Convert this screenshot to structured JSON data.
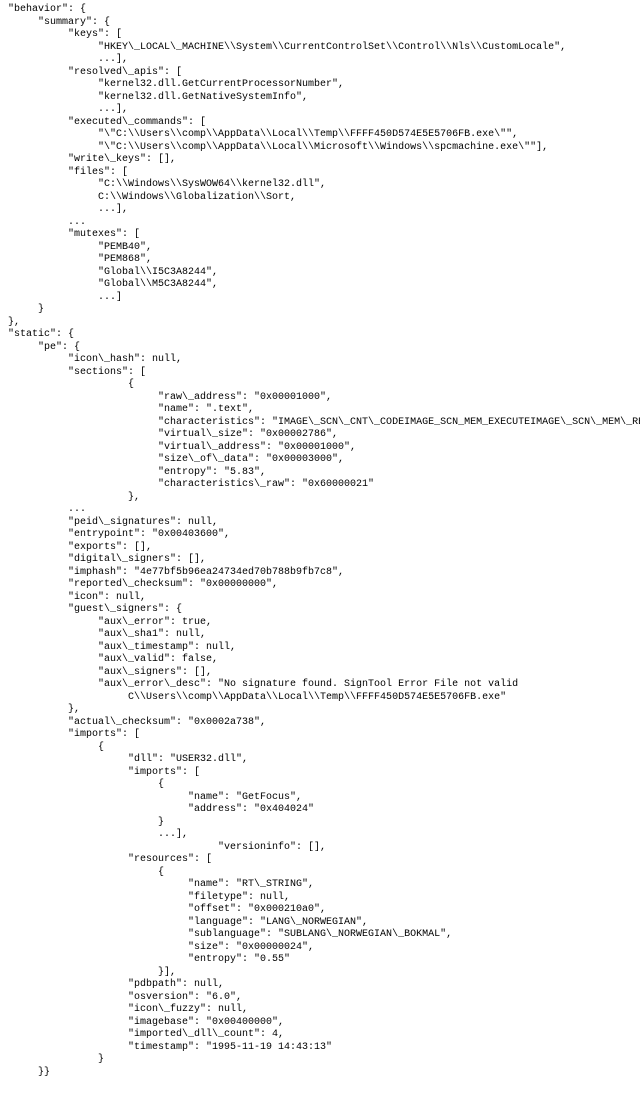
{
  "lines": [
    {
      "indent": 0,
      "text": "\"behavior\": {"
    },
    {
      "indent": 1,
      "text": "\"summary\": {"
    },
    {
      "indent": 2,
      "text": "\"keys\": ["
    },
    {
      "indent": 3,
      "text": "\"HKEY\\_LOCAL\\_MACHINE\\\\System\\\\CurrentControlSet\\\\Control\\\\Nls\\\\CustomLocale\","
    },
    {
      "indent": 3,
      "text": "...],"
    },
    {
      "indent": 2,
      "text": "\"resolved\\_apis\": ["
    },
    {
      "indent": 3,
      "text": "\"kernel32.dll.GetCurrentProcessorNumber\","
    },
    {
      "indent": 3,
      "text": "\"kernel32.dll.GetNativeSystemInfo\","
    },
    {
      "indent": 3,
      "text": "...],"
    },
    {
      "indent": 2,
      "text": "\"executed\\_commands\": ["
    },
    {
      "indent": 3,
      "text": "\"\\\"C:\\\\Users\\\\comp\\\\AppData\\\\Local\\\\Temp\\\\FFFF450D574E5E5706FB.exe\\\"\","
    },
    {
      "indent": 3,
      "text": "\"\\\"C:\\\\Users\\\\comp\\\\AppData\\\\Local\\\\Microsoft\\\\Windows\\\\spcmachine.exe\\\"\"],"
    },
    {
      "indent": 2,
      "text": "\"write\\_keys\": [],"
    },
    {
      "indent": 2,
      "text": "\"files\": ["
    },
    {
      "indent": 3,
      "text": "\"C:\\\\Windows\\\\SysWOW64\\\\kernel32.dll\","
    },
    {
      "indent": 3,
      "text": "C:\\\\Windows\\\\Globalization\\\\Sort,"
    },
    {
      "indent": 3,
      "text": "...],"
    },
    {
      "indent": 2,
      "text": "..."
    },
    {
      "indent": 2,
      "text": "\"mutexes\": ["
    },
    {
      "indent": 3,
      "text": "\"PEMB40\","
    },
    {
      "indent": 3,
      "text": "\"PEM868\","
    },
    {
      "indent": 3,
      "text": "\"Global\\\\I5C3A8244\","
    },
    {
      "indent": 3,
      "text": "\"Global\\\\M5C3A8244\","
    },
    {
      "indent": 3,
      "text": "...]"
    },
    {
      "indent": 1,
      "text": "}"
    },
    {
      "indent": 0,
      "text": "},"
    },
    {
      "indent": 0,
      "text": "\"static\": {"
    },
    {
      "indent": 1,
      "text": "\"pe\": {"
    },
    {
      "indent": 2,
      "text": "\"icon\\_hash\": null,"
    },
    {
      "indent": 2,
      "text": "\"sections\": ["
    },
    {
      "indent": 4,
      "text": "{"
    },
    {
      "indent": 5,
      "text": "\"raw\\_address\": \"0x00001000\","
    },
    {
      "indent": 5,
      "text": "\"name\": \".text\","
    },
    {
      "indent": 5,
      "text": "\"characteristics\": \"IMAGE\\_SCN\\_CNT\\_CODEIMAGE_SCN_MEM_EXECUTEIMAGE\\_SCN\\_MEM\\_READ\","
    },
    {
      "indent": 5,
      "text": "\"virtual\\_size\": \"0x00002786\","
    },
    {
      "indent": 5,
      "text": "\"virtual\\_address\": \"0x00001000\","
    },
    {
      "indent": 5,
      "text": "\"size\\_of\\_data\": \"0x00003000\","
    },
    {
      "indent": 5,
      "text": "\"entropy\": \"5.83\","
    },
    {
      "indent": 5,
      "text": "\"characteristics\\_raw\": \"0x60000021\""
    },
    {
      "indent": 4,
      "text": "},"
    },
    {
      "indent": 2,
      "text": "..."
    },
    {
      "indent": 2,
      "text": "\"peid\\_signatures\": null,"
    },
    {
      "indent": 2,
      "text": "\"entrypoint\": \"0x00403600\","
    },
    {
      "indent": 2,
      "text": "\"exports\": [],"
    },
    {
      "indent": 2,
      "text": "\"digital\\_signers\": [],"
    },
    {
      "indent": 2,
      "text": "\"imphash\": \"4e77bf5b96ea24734ed70b788b9fb7c8\","
    },
    {
      "indent": 2,
      "text": "\"reported\\_checksum\": \"0x00000000\","
    },
    {
      "indent": 2,
      "text": "\"icon\": null,"
    },
    {
      "indent": 2,
      "text": "\"guest\\_signers\": {"
    },
    {
      "indent": 3,
      "text": "\"aux\\_error\": true,"
    },
    {
      "indent": 3,
      "text": "\"aux\\_sha1\": null,"
    },
    {
      "indent": 3,
      "text": "\"aux\\_timestamp\": null,"
    },
    {
      "indent": 3,
      "text": "\"aux\\_valid\": false,"
    },
    {
      "indent": 3,
      "text": "\"aux\\_signers\": [],"
    },
    {
      "indent": 3,
      "text": "\"aux\\_error\\_desc\": \"No signature found. SignTool Error File not valid"
    },
    {
      "indent": 4,
      "text": "C\\\\Users\\\\comp\\\\AppData\\\\Local\\\\Temp\\\\FFFF450D574E5E5706FB.exe\""
    },
    {
      "indent": 2,
      "text": "},"
    },
    {
      "indent": 2,
      "text": "\"actual\\_checksum\": \"0x0002a738\","
    },
    {
      "indent": 2,
      "text": "\"imports\": ["
    },
    {
      "indent": 3,
      "text": "{"
    },
    {
      "indent": 4,
      "text": "\"dll\": \"USER32.dll\","
    },
    {
      "indent": 4,
      "text": "\"imports\": ["
    },
    {
      "indent": 5,
      "text": "{"
    },
    {
      "indent": 6,
      "text": "\"name\": \"GetFocus\","
    },
    {
      "indent": 6,
      "text": "\"address\": \"0x404024\""
    },
    {
      "indent": 5,
      "text": "}"
    },
    {
      "indent": 5,
      "text": "...],"
    },
    {
      "indent": 7,
      "text": "\"versioninfo\": [],"
    },
    {
      "indent": 4,
      "text": "\"resources\": ["
    },
    {
      "indent": 5,
      "text": "{"
    },
    {
      "indent": 6,
      "text": "\"name\": \"RT\\_STRING\","
    },
    {
      "indent": 6,
      "text": "\"filetype\": null,"
    },
    {
      "indent": 6,
      "text": "\"offset\": \"0x000210a0\","
    },
    {
      "indent": 6,
      "text": "\"language\": \"LANG\\_NORWEGIAN\","
    },
    {
      "indent": 6,
      "text": "\"sublanguage\": \"SUBLANG\\_NORWEGIAN\\_BOKMAL\","
    },
    {
      "indent": 6,
      "text": "\"size\": \"0x00000024\","
    },
    {
      "indent": 6,
      "text": "\"entropy\": \"0.55\""
    },
    {
      "indent": 5,
      "text": "}],"
    },
    {
      "indent": 4,
      "text": "\"pdbpath\": null,"
    },
    {
      "indent": 4,
      "text": "\"osversion\": \"6.0\","
    },
    {
      "indent": 4,
      "text": "\"icon\\_fuzzy\": null,"
    },
    {
      "indent": 4,
      "text": "\"imagebase\": \"0x00400000\","
    },
    {
      "indent": 4,
      "text": "\"imported\\_dll\\_count\": 4,"
    },
    {
      "indent": 4,
      "text": "\"timestamp\": \"1995-11-19 14:43:13\""
    },
    {
      "indent": 3,
      "text": "}"
    },
    {
      "indent": 1,
      "text": "}}"
    }
  ],
  "indentUnit": "     "
}
